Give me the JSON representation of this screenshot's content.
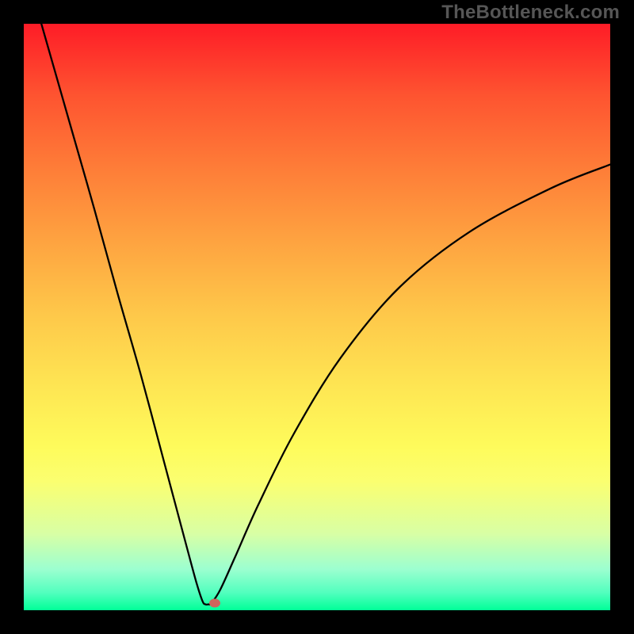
{
  "watermark": "TheBottleneck.com",
  "chart_data": {
    "type": "line",
    "title": "",
    "xlabel": "",
    "ylabel": "",
    "xlim": [
      0,
      100
    ],
    "ylim": [
      0,
      100
    ],
    "series": [
      {
        "name": "bottleneck-curve",
        "x": [
          3,
          5,
          8,
          12,
          16,
          20,
          24,
          26,
          28,
          29.5,
          30.5,
          31,
          31.5,
          32,
          33.5,
          36,
          40,
          46,
          54,
          64,
          76,
          90,
          100
        ],
        "y": [
          100,
          93,
          82.5,
          68.5,
          54,
          40,
          25,
          17.5,
          10,
          4.5,
          1.5,
          1,
          1,
          1.2,
          3.5,
          9,
          18,
          30,
          43,
          55,
          64.5,
          72,
          76
        ]
      }
    ],
    "markers": [
      {
        "name": "optimum-point",
        "x": 32.5,
        "y": 1.2,
        "color": "#cf645c"
      }
    ],
    "background_gradient": {
      "top": "#fe1c27",
      "bottom": "#00ff98"
    }
  }
}
